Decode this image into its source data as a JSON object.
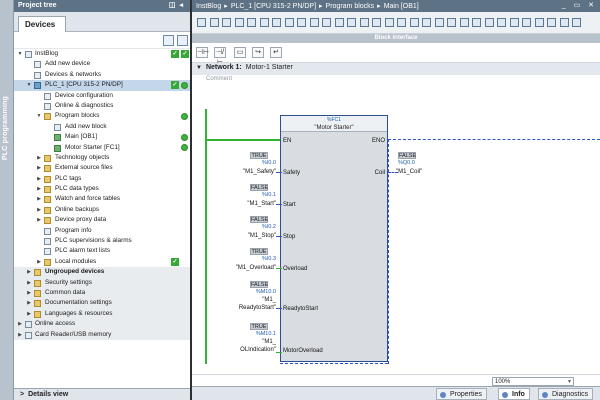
{
  "sidebar": {
    "vertical_label": "PLC programming"
  },
  "tree": {
    "title": "Project tree",
    "tab": "Devices",
    "details_view": "Details view",
    "items": [
      {
        "label": "InstBlog",
        "level": 0
      },
      {
        "label": "Add new device",
        "level": 1
      },
      {
        "label": "Devices & networks",
        "level": 1
      },
      {
        "label": "PLC_1 [CPU 315-2 PN/DP]",
        "level": 1
      },
      {
        "label": "Device configuration",
        "level": 2
      },
      {
        "label": "Online & diagnostics",
        "level": 2
      },
      {
        "label": "Program blocks",
        "level": 2
      },
      {
        "label": "Add new block",
        "level": 3
      },
      {
        "label": "Main [OB1]",
        "level": 3
      },
      {
        "label": "Motor Starter [FC1]",
        "level": 3
      },
      {
        "label": "Technology objects",
        "level": 2
      },
      {
        "label": "External source files",
        "level": 2
      },
      {
        "label": "PLC tags",
        "level": 2
      },
      {
        "label": "PLC data types",
        "level": 2
      },
      {
        "label": "Watch and force tables",
        "level": 2
      },
      {
        "label": "Online backups",
        "level": 2
      },
      {
        "label": "Device proxy data",
        "level": 2
      },
      {
        "label": "Program info",
        "level": 2
      },
      {
        "label": "PLC supervisions & alarms",
        "level": 2
      },
      {
        "label": "PLC alarm text lists",
        "level": 2
      },
      {
        "label": "Local modules",
        "level": 2
      },
      {
        "label": "Ungrouped devices",
        "level": 1
      },
      {
        "label": "Security settings",
        "level": 1
      },
      {
        "label": "Common data",
        "level": 1
      },
      {
        "label": "Documentation settings",
        "level": 1
      },
      {
        "label": "Languages & resources",
        "level": 1
      },
      {
        "label": "Online access",
        "level": 0
      },
      {
        "label": "Card Reader/USB memory",
        "level": 0
      }
    ]
  },
  "editor": {
    "breadcrumb": [
      "InstBlog",
      "PLC_1 [CPU 315-2 PN/DP]",
      "Program blocks",
      "Main [OB1]"
    ],
    "block_interface": "Block interface",
    "network": {
      "label": "Network 1:",
      "title": "Motor-1 Starter",
      "comment": "Comment"
    },
    "fb": {
      "db": "%FC1",
      "name": "\"Motor Starter\"",
      "en": "EN",
      "eno": "ENO",
      "inputs": [
        {
          "pin": "Safety",
          "value": "TRUE",
          "addr": "%I0.0",
          "tag": "\"M1_Safety\""
        },
        {
          "pin": "Start",
          "value": "FALSE",
          "addr": "%I0.1",
          "tag": "\"M1_Start\""
        },
        {
          "pin": "Stop",
          "value": "FALSE",
          "addr": "%I0.2",
          "tag": "\"M1_Stop\""
        },
        {
          "pin": "Overload",
          "value": "TRUE",
          "addr": "%I0.3",
          "tag": "\"M1_Overload\""
        },
        {
          "pin": "ReadytoStart",
          "value": "FALSE",
          "addr": "%M10.0",
          "tag1": "\"M1_",
          "tag2": "ReadytoStart\""
        },
        {
          "pin": "MotorOverload",
          "value": "TRUE",
          "addr": "%M10.1",
          "tag1": "\"M1_",
          "tag2": "OLIndication\""
        }
      ],
      "output": {
        "pin": "Coil",
        "value": "FALSE",
        "addr": "%Q0.0",
        "tag": "\"M1_Coil\""
      }
    },
    "zoom": "100%"
  },
  "inspector": {
    "tabs": [
      "Properties",
      "Info",
      "Diagnostics"
    ],
    "active": "Info"
  },
  "colors": {
    "title_bar": "#5d7284",
    "selection": "#c3d6ea",
    "energized": "#33b233",
    "fb_border": "#2c4f91",
    "address": "#1e5aa8",
    "status_ok": "#35a835"
  }
}
